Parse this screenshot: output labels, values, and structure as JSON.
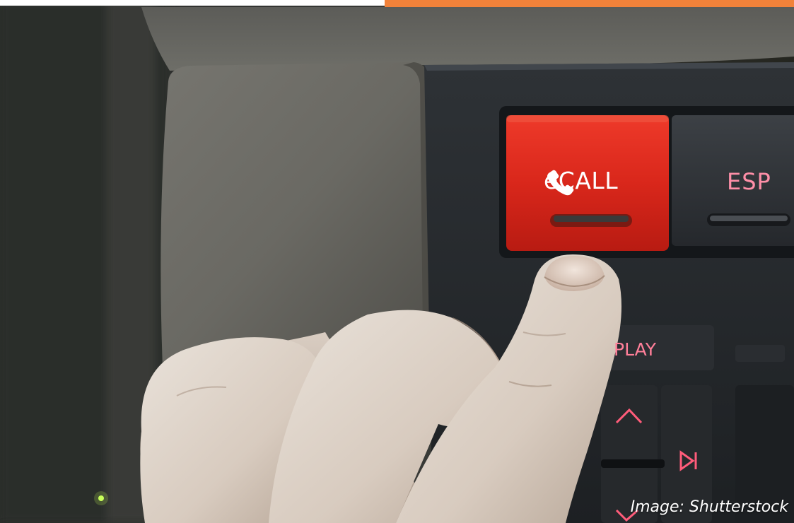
{
  "photo": {
    "buttons": {
      "ecall": "eCALL",
      "esp": "ESP",
      "display_partial": "PLAY"
    },
    "icons": {
      "phone": "phone-icon",
      "up": "chevron-up-icon",
      "down": "chevron-down-icon",
      "skip": "skip-forward-icon"
    },
    "colors": {
      "ecall_button": "#d9271b",
      "button_text_pink": "#ff7f99",
      "accent_bar": "#f2823a"
    }
  },
  "caption": "Image: Shutterstock"
}
